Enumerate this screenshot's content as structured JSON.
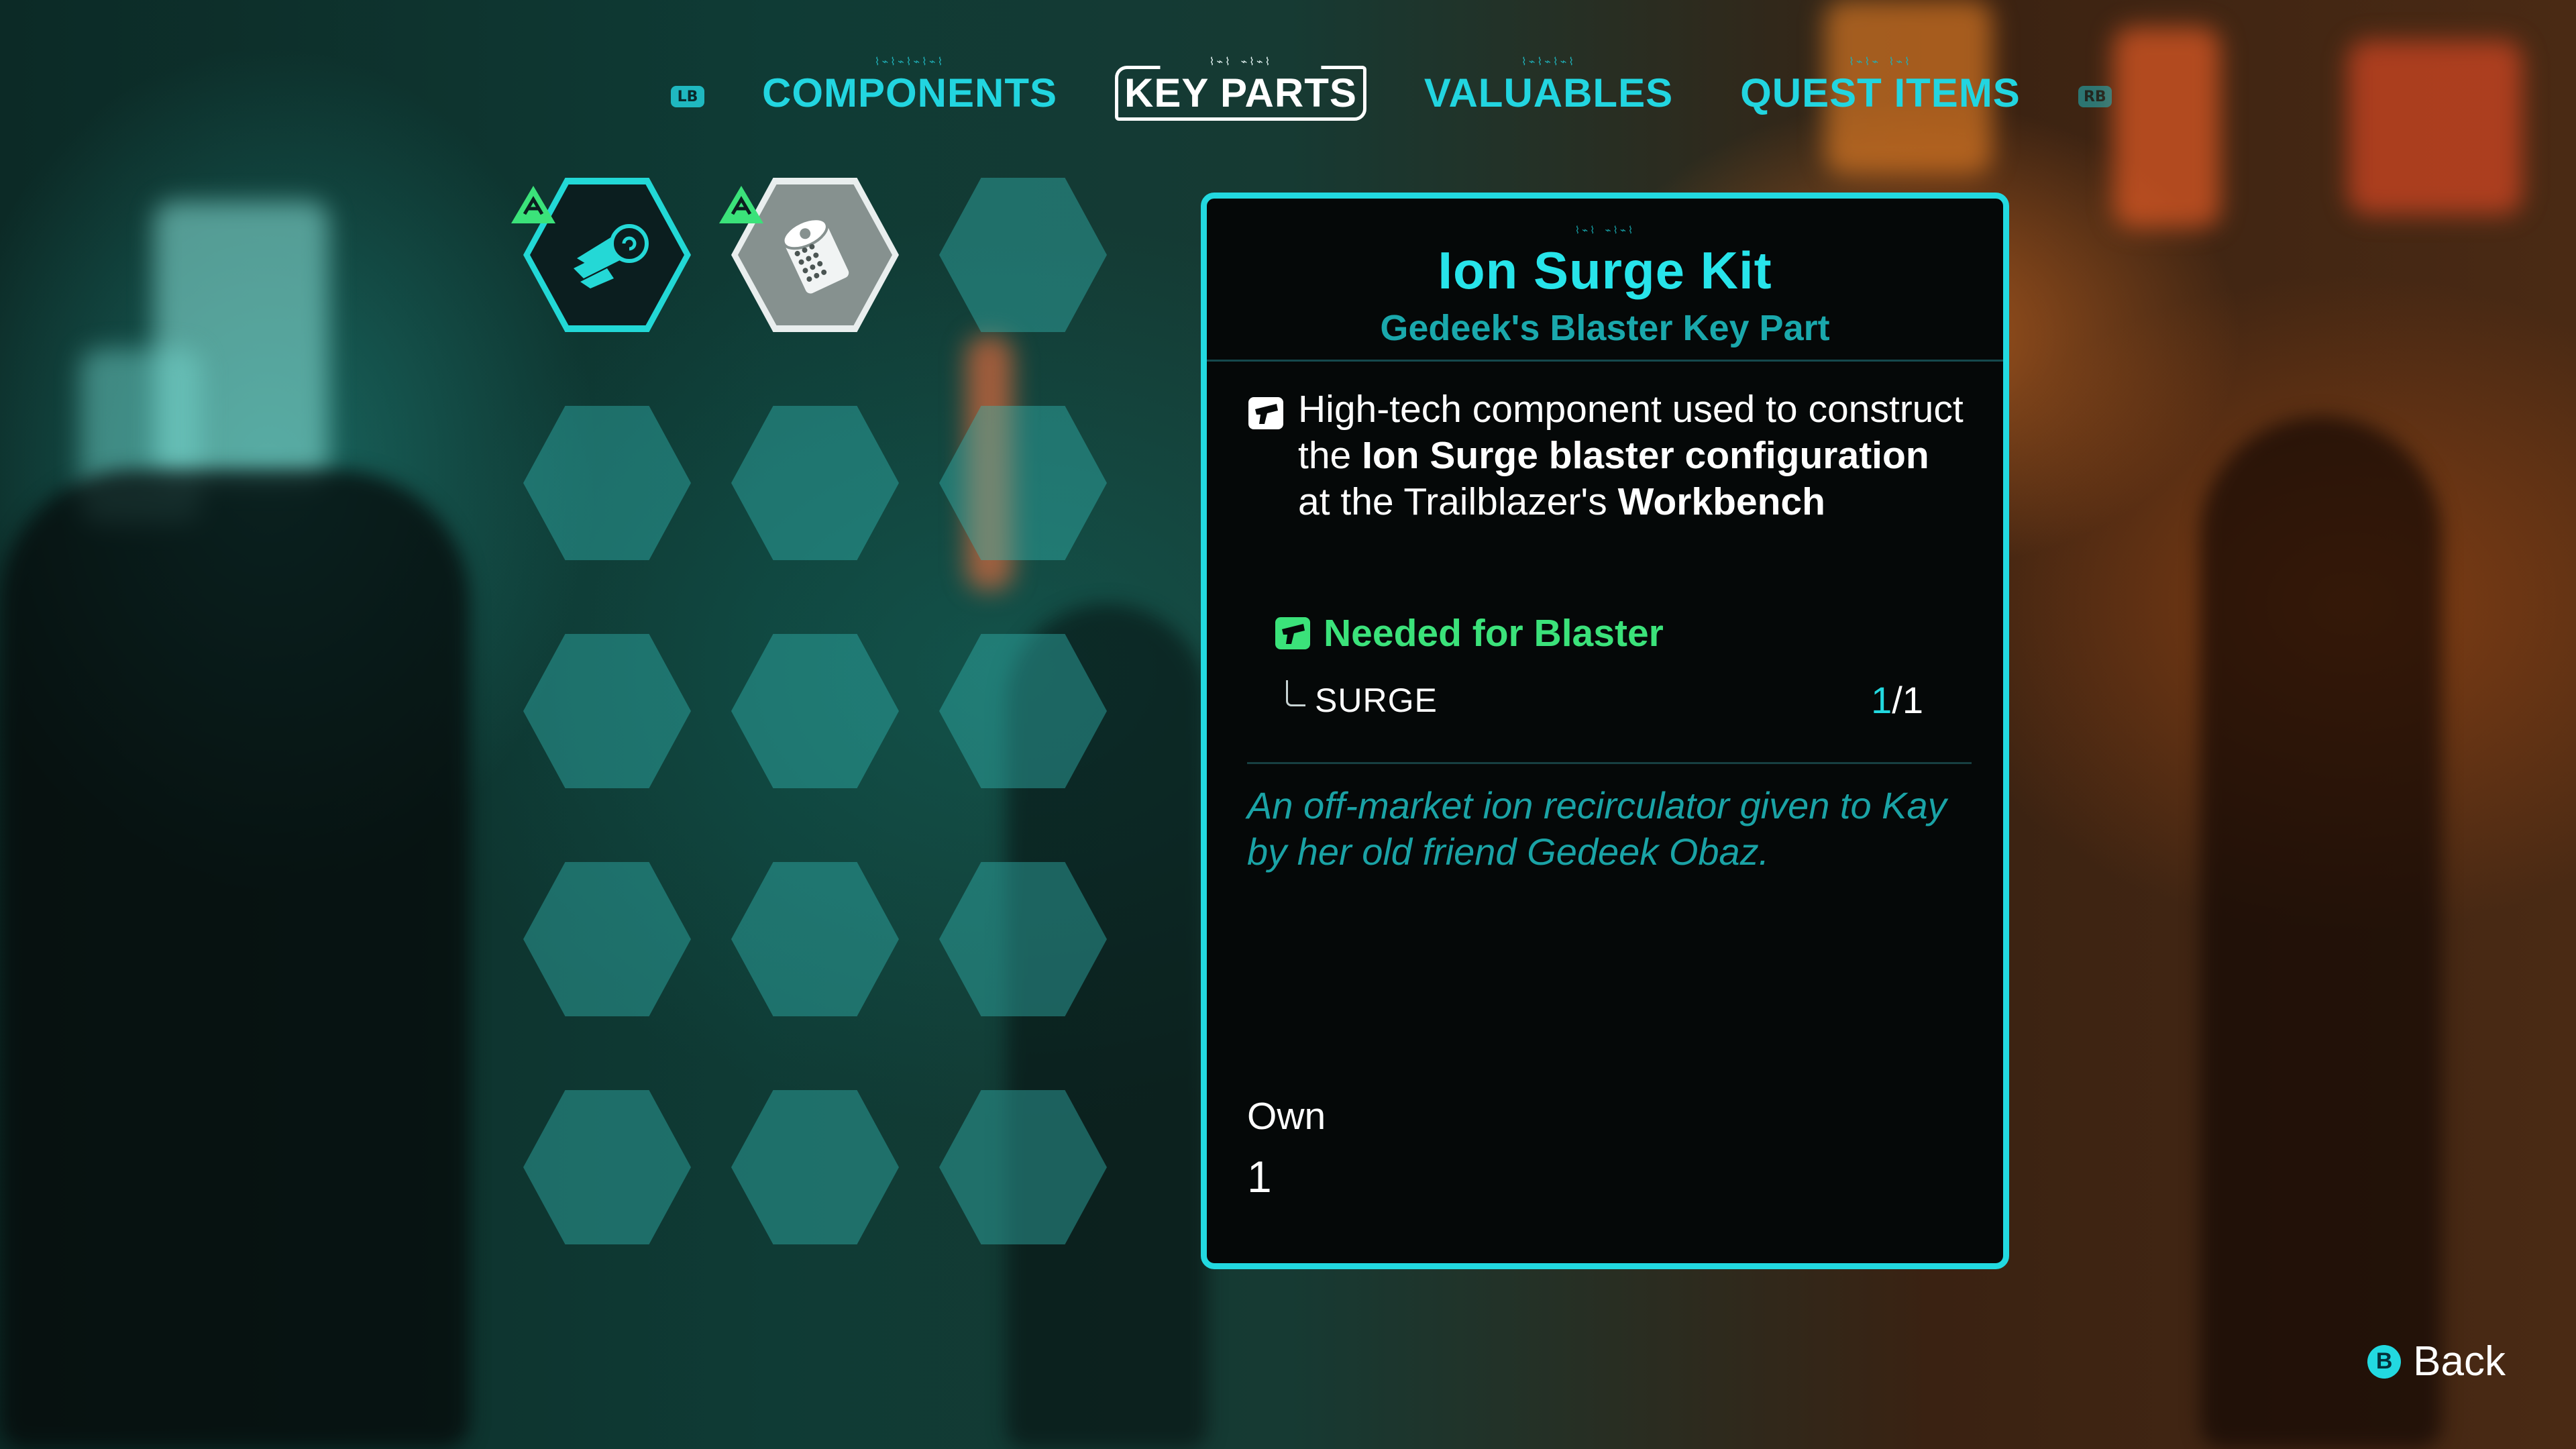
{
  "tabs": {
    "left_bumper": "LB",
    "right_bumper": "RB",
    "items": [
      {
        "label": "COMPONENTS",
        "active": false
      },
      {
        "label": "KEY PARTS",
        "active": true
      },
      {
        "label": "VALUABLES",
        "active": false
      },
      {
        "label": "QUEST ITEMS",
        "active": false
      }
    ]
  },
  "grid": {
    "slots": [
      {
        "icon": "scroll-roll-icon",
        "state": "owned",
        "new": true
      },
      {
        "icon": "ion-canister-icon",
        "state": "selected",
        "new": true
      },
      {
        "icon": "",
        "state": "empty",
        "new": false
      }
    ],
    "rows": 5,
    "columns": 3
  },
  "detail": {
    "title": "Ion Surge Kit",
    "subtitle": "Gedeek's Blaster Key Part",
    "description": {
      "part1": "High-tech component used to construct the ",
      "bold1": "Ion Surge blaster configuration",
      "part2": " at the Trailblazer's ",
      "bold2": "Workbench"
    },
    "needed_for": "Needed for Blaster",
    "requirement": {
      "name": "SURGE",
      "have": "1",
      "need": "/1"
    },
    "flavor": "An off-market ion recirculator given to Kay by her old friend Gedeek Obaz.",
    "own_label": "Own",
    "own_value": "1"
  },
  "footer": {
    "back_button": "B",
    "back_label": "Back"
  },
  "colors": {
    "accent": "#22d9e0",
    "needed_green": "#3be27a",
    "subtitle_teal": "#1aa8ac"
  }
}
